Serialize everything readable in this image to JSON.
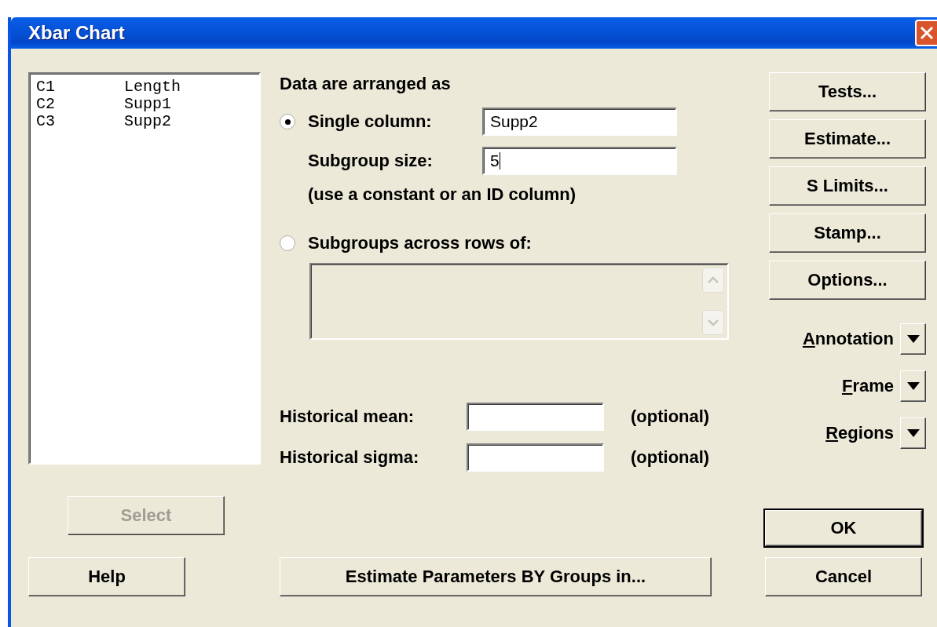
{
  "window": {
    "title": "Xbar Chart"
  },
  "variables": [
    {
      "column": "C1",
      "name": "Length"
    },
    {
      "column": "C2",
      "name": "Supp1"
    },
    {
      "column": "C3",
      "name": "Supp2"
    }
  ],
  "heading": "Data are arranged as",
  "single_column": {
    "label": "Single column:",
    "selected": true,
    "value": "Supp2"
  },
  "subgroup_size": {
    "label": "Subgroup size:",
    "value": "5",
    "focused": true,
    "hint": "(use a constant or an ID column)"
  },
  "across_rows": {
    "label": "Subgroups across rows of:",
    "selected": false,
    "disabled": true
  },
  "historical": [
    {
      "label": "Historical mean:",
      "note": "(optional)"
    },
    {
      "label": "Historical sigma:",
      "note": "(optional)"
    }
  ],
  "side_buttons": [
    {
      "label": "Tests..."
    },
    {
      "label": "Estimate..."
    },
    {
      "label": "S Limits..."
    },
    {
      "label": "Stamp..."
    },
    {
      "label": "Options..."
    }
  ],
  "dropdowns": [
    {
      "label": "Annotation",
      "underline_first": true
    },
    {
      "label": "Frame",
      "underline_first": true
    },
    {
      "label": "Regions",
      "underline_first": true
    }
  ],
  "select_button": {
    "label": "Select",
    "disabled": true
  },
  "help_button": {
    "label": "Help"
  },
  "estimate_by_groups_button": {
    "label": "Estimate Parameters BY Groups in..."
  },
  "ok_button": {
    "label": "OK",
    "default": true
  },
  "cancel_button": {
    "label": "Cancel"
  }
}
